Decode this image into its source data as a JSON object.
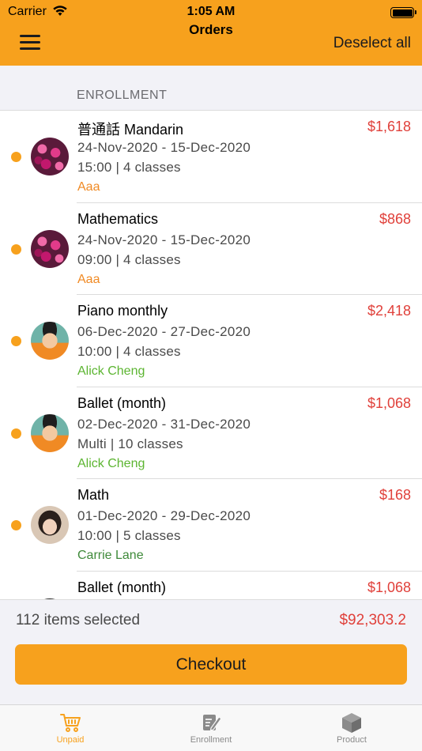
{
  "status_bar": {
    "carrier": "Carrier",
    "time": "1:05 AM"
  },
  "nav": {
    "title": "Orders",
    "deselect_label": "Deselect all",
    "menu_icon": "hamburger-icon"
  },
  "section": {
    "header": "ENROLLMENT"
  },
  "orders": [
    {
      "title": "普通話 Mandarin",
      "price": "$1,618",
      "dates": "24-Nov-2020  -  15-Dec-2020",
      "meta": "15:00  |  4 classes",
      "student": "Aaa",
      "student_color": "#f08a24",
      "avatar": "flower"
    },
    {
      "title": "Mathematics",
      "price": "$868",
      "dates": "24-Nov-2020  -  15-Dec-2020",
      "meta": "09:00  |  4 classes",
      "student": "Aaa",
      "student_color": "#f08a24",
      "avatar": "flower"
    },
    {
      "title": "Piano monthly",
      "price": "$2,418",
      "dates": "06-Dec-2020  -  27-Dec-2020",
      "meta": "10:00  |  4 classes",
      "student": "Alick Cheng",
      "student_color": "#5cb531",
      "avatar": "boy"
    },
    {
      "title": "Ballet (month)",
      "price": "$1,068",
      "dates": "02-Dec-2020  -  31-Dec-2020",
      "meta": "Multi  |  10 classes",
      "student": "Alick Cheng",
      "student_color": "#5cb531",
      "avatar": "boy"
    },
    {
      "title": "Math",
      "price": "$168",
      "dates": "01-Dec-2020  -  29-Dec-2020",
      "meta": "10:00  |  5 classes",
      "student": "Carrie Lane",
      "student_color": "#3f8a3a",
      "avatar": "girl"
    },
    {
      "title": "Ballet (month)",
      "price": "$1,068",
      "dates": "",
      "meta": "",
      "student": "",
      "student_color": "#5cb531",
      "avatar": "none"
    }
  ],
  "summary": {
    "selected_text": "112 items selected",
    "total": "$92,303.2",
    "checkout_label": "Checkout"
  },
  "tabs": [
    {
      "label": "Unpaid",
      "icon": "cart-icon",
      "active": true
    },
    {
      "label": "Enrollment",
      "icon": "document-edit-icon",
      "active": false
    },
    {
      "label": "Product",
      "icon": "box-icon",
      "active": false
    }
  ],
  "colors": {
    "accent": "#f7a11d",
    "price": "#e0403a"
  }
}
